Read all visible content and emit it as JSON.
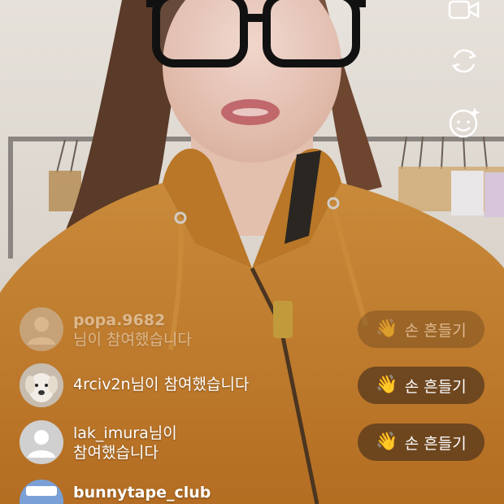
{
  "live": {
    "top_icons": [
      "video-camera-icon",
      "flip-camera-icon",
      "face-effects-icon"
    ]
  },
  "comments": [
    {
      "username": "popa.9682",
      "line1": "popa.9682",
      "line2": "님이 참여했습니다",
      "wave_label": "손 흔들기",
      "avatar": "default-avatar"
    },
    {
      "username": "4rciv2n",
      "line1": "4rciv2n님이 참여했습니다",
      "line2": "",
      "wave_label": "손 흔들기",
      "avatar": "puppy-avatar"
    },
    {
      "username": "lak_imura",
      "line1": "lak_imura님이",
      "line2": "참여했습니다",
      "wave_label": "손 흔들기",
      "avatar": "default-avatar"
    },
    {
      "username": "bunnytape_club",
      "line1": "bunnytape_club",
      "line2": "",
      "wave_label": "",
      "avatar": "brand-avatar"
    }
  ],
  "colors": {
    "hoodie": "#c98332",
    "wave_bg": "#50341c",
    "hand": "#f7c12f"
  }
}
